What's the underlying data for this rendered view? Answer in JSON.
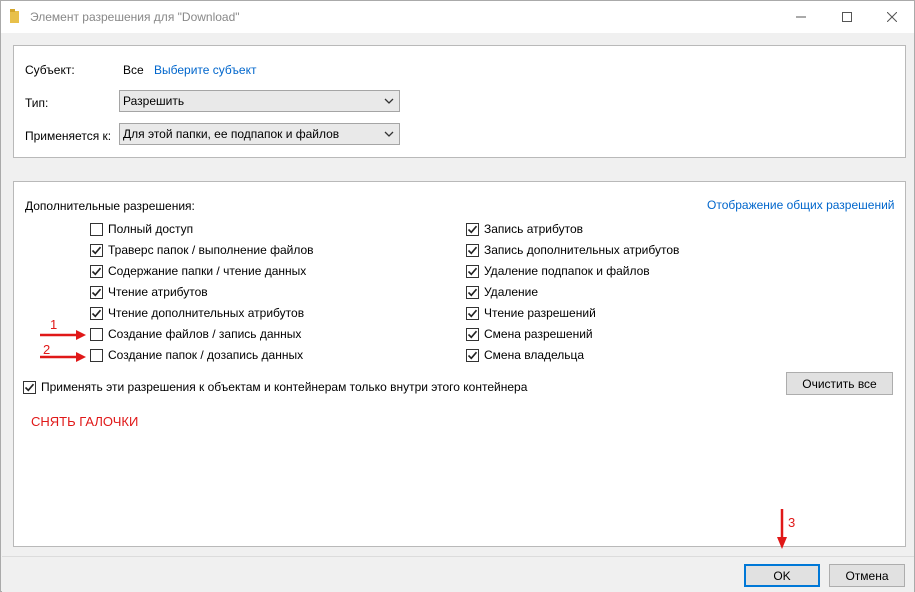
{
  "window": {
    "title": "Элемент разрешения для \"Download\"",
    "minimize_icon": "minimize-icon",
    "maximize_icon": "maximize-icon",
    "close_icon": "close-icon"
  },
  "subject": {
    "label": "Субъект:",
    "value": "Все",
    "select_link": "Выберите субъект"
  },
  "type": {
    "label": "Тип:",
    "selected": "Разрешить"
  },
  "applies": {
    "label": "Применяется к:",
    "selected": "Для этой папки, ее подпапок и файлов"
  },
  "permissions": {
    "heading": "Дополнительные разрешения:",
    "show_basic_link": "Отображение общих разрешений",
    "left": [
      {
        "label": "Полный доступ",
        "checked": false
      },
      {
        "label": "Траверс папок / выполнение файлов",
        "checked": true
      },
      {
        "label": "Содержание папки / чтение данных",
        "checked": true
      },
      {
        "label": "Чтение атрибутов",
        "checked": true
      },
      {
        "label": "Чтение дополнительных атрибутов",
        "checked": true
      },
      {
        "label": "Создание файлов / запись данных",
        "checked": false
      },
      {
        "label": "Создание папок / дозапись данных",
        "checked": false
      }
    ],
    "right": [
      {
        "label": "Запись атрибутов",
        "checked": true
      },
      {
        "label": "Запись дополнительных атрибутов",
        "checked": true
      },
      {
        "label": "Удаление подпапок и файлов",
        "checked": true
      },
      {
        "label": "Удаление",
        "checked": true
      },
      {
        "label": "Чтение разрешений",
        "checked": true
      },
      {
        "label": "Смена разрешений",
        "checked": true
      },
      {
        "label": "Смена владельца",
        "checked": true
      }
    ],
    "apply_inside": {
      "label": "Применять эти разрешения к объектам и контейнерам только внутри этого контейнера",
      "checked": true
    },
    "clear_all": "Очистить все"
  },
  "annotations": {
    "arrow1_num": "1",
    "arrow2_num": "2",
    "arrow3_num": "3",
    "note": "СНЯТЬ ГАЛОЧКИ",
    "color": "#e01818"
  },
  "footer": {
    "ok": "OK",
    "cancel": "Отмена"
  }
}
